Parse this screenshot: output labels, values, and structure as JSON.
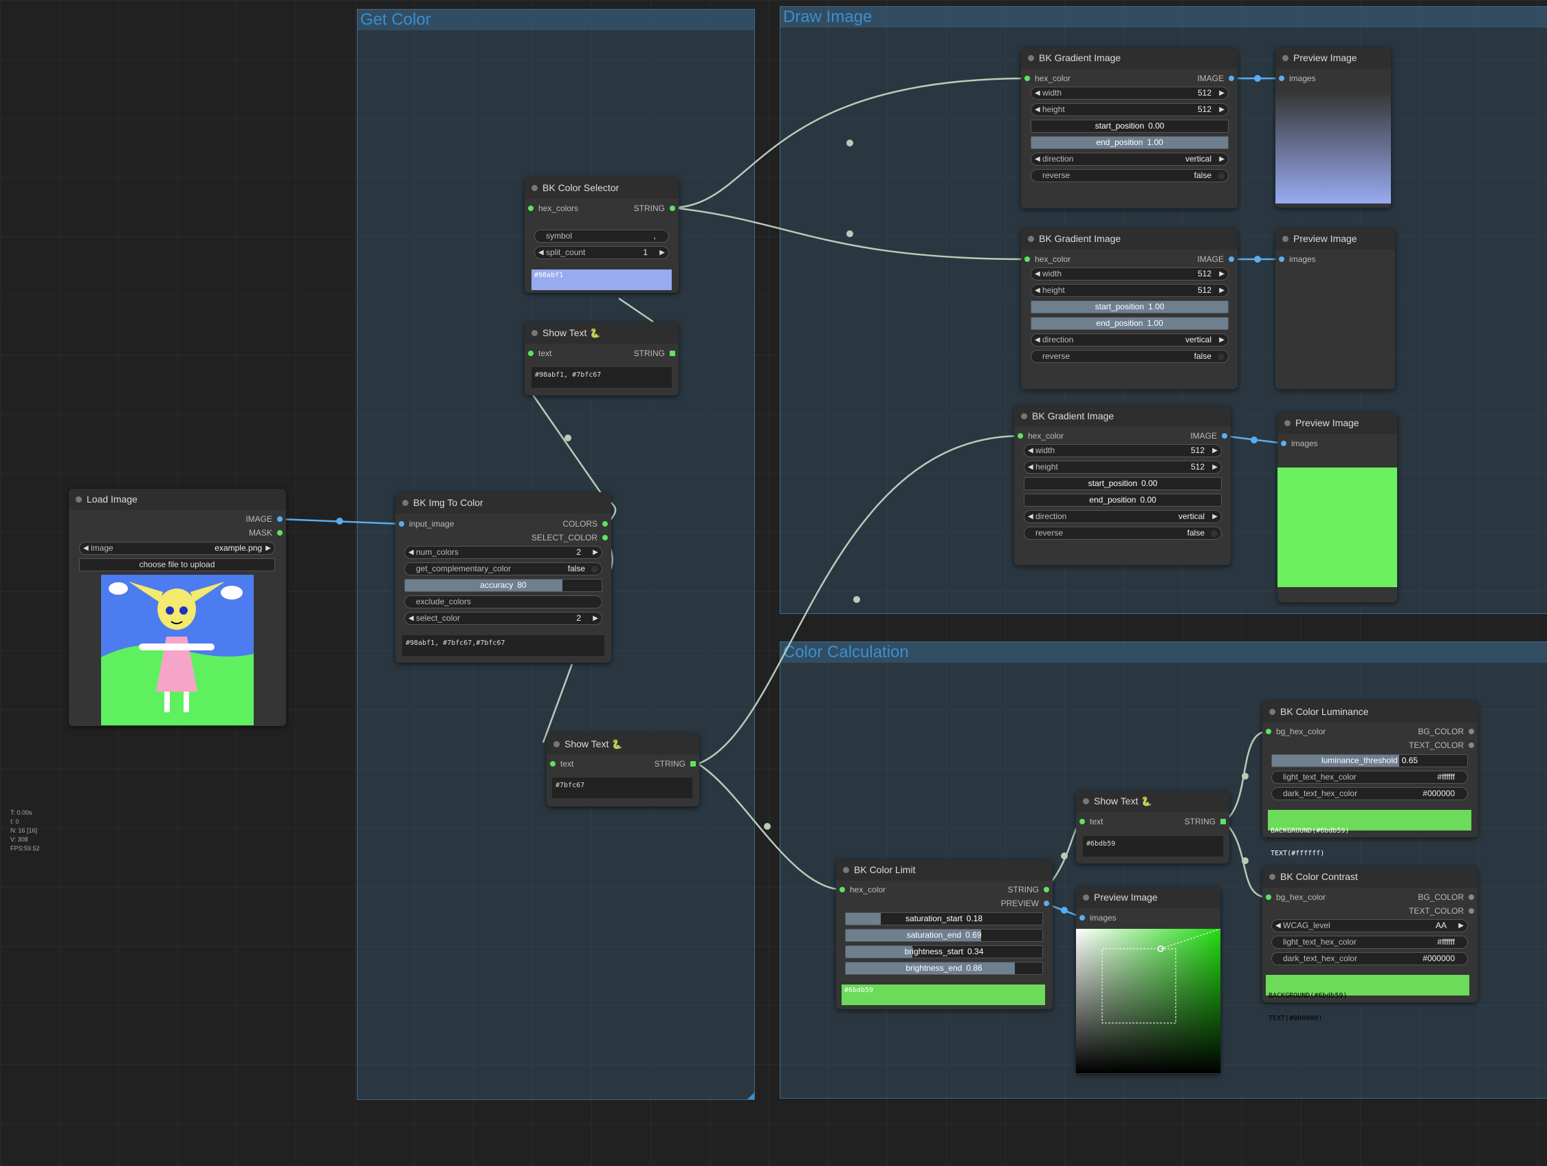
{
  "groups": {
    "get_color": "Get Color",
    "draw_image": "Draw Image",
    "color_calculation": "Color Calculation"
  },
  "load_image": {
    "title": "Load Image",
    "out_image": "IMAGE",
    "out_mask": "MASK",
    "image_label": "image",
    "image_value": "example.png",
    "upload_button": "choose file to upload"
  },
  "color_selector": {
    "title": "BK Color Selector",
    "in_hex_colors": "hex_colors",
    "out_string": "STRING",
    "symbol_label": "symbol",
    "symbol_value": ",",
    "split_count_label": "split_count",
    "split_count_value": "1",
    "swatch_text": "#98abf1",
    "swatch_color": "#98abf1"
  },
  "show_text_1": {
    "title": "Show Text",
    "in_text": "text",
    "out_string": "STRING",
    "content": "#98abf1, #7bfc67"
  },
  "img_to_color": {
    "title": "BK Img To Color",
    "in_input_image": "input_image",
    "out_colors": "COLORS",
    "out_select_color": "SELECT_COLOR",
    "num_colors_label": "num_colors",
    "num_colors_value": "2",
    "get_complementary_label": "get_complementary_color",
    "get_complementary_value": "false",
    "accuracy_label": "accuracy",
    "accuracy_value": "80",
    "accuracy_fraction": 0.8,
    "exclude_colors_label": "exclude_colors",
    "select_color_label": "select_color",
    "select_color_value": "2",
    "output_text": "#98abf1, #7bfc67,#7bfc67"
  },
  "show_text_2": {
    "title": "Show Text",
    "in_text": "text",
    "out_string": "STRING",
    "content": "#7bfc67"
  },
  "gradient_1": {
    "title": "BK Gradient Image",
    "in_hex_color": "hex_color",
    "out_image": "IMAGE",
    "width_label": "width",
    "width_value": "512",
    "height_label": "height",
    "height_value": "512",
    "start_position_label": "start_position",
    "start_position_value": "0.00",
    "start_position_fraction": 0.0,
    "end_position_label": "end_position",
    "end_position_value": "1.00",
    "end_position_fraction": 1.0,
    "direction_label": "direction",
    "direction_value": "vertical",
    "reverse_label": "reverse",
    "reverse_value": "false"
  },
  "gradient_2": {
    "title": "BK Gradient Image",
    "in_hex_color": "hex_color",
    "out_image": "IMAGE",
    "width_label": "width",
    "width_value": "512",
    "height_label": "height",
    "height_value": "512",
    "start_position_label": "start_position",
    "start_position_value": "1.00",
    "start_position_fraction": 1.0,
    "end_position_label": "end_position",
    "end_position_value": "1.00",
    "end_position_fraction": 1.0,
    "direction_label": "direction",
    "direction_value": "vertical",
    "reverse_label": "reverse",
    "reverse_value": "false"
  },
  "gradient_3": {
    "title": "BK Gradient Image",
    "in_hex_color": "hex_color",
    "out_image": "IMAGE",
    "width_label": "width",
    "width_value": "512",
    "height_label": "height",
    "height_value": "512",
    "start_position_label": "start_position",
    "start_position_value": "0.00",
    "start_position_fraction": 0.0,
    "end_position_label": "end_position",
    "end_position_value": "0.00",
    "end_position_fraction": 0.0,
    "direction_label": "direction",
    "direction_value": "vertical",
    "reverse_label": "reverse",
    "reverse_value": "false"
  },
  "preview_1": {
    "title": "Preview Image",
    "in_images": "images"
  },
  "preview_2": {
    "title": "Preview Image",
    "in_images": "images"
  },
  "preview_3": {
    "title": "Preview Image",
    "in_images": "images",
    "fill_color": "#6cf05f"
  },
  "preview_4": {
    "title": "Preview Image",
    "in_images": "images"
  },
  "color_limit": {
    "title": "BK Color Limit",
    "in_hex_color": "hex_color",
    "out_string": "STRING",
    "out_preview": "PREVIEW",
    "saturation_start_label": "saturation_start",
    "saturation_start_value": "0.18",
    "saturation_start_fraction": 0.18,
    "saturation_end_label": "saturation_end",
    "saturation_end_value": "0.69",
    "saturation_end_fraction": 0.69,
    "brightness_start_label": "brightness_start",
    "brightness_start_value": "0.34",
    "brightness_start_fraction": 0.34,
    "brightness_end_label": "brightness_end",
    "brightness_end_value": "0.86",
    "brightness_end_fraction": 0.86,
    "swatch_text": "#6bdb59",
    "swatch_color": "#6bdb59"
  },
  "show_text_3": {
    "title": "Show Text",
    "in_text": "text",
    "out_string": "STRING",
    "content": "#6bdb59"
  },
  "luminance": {
    "title": "BK Color Luminance",
    "in_bg_hex_color": "bg_hex_color",
    "out_bg_color": "BG_COLOR",
    "out_text_color": "TEXT_COLOR",
    "luminance_threshold_label": "luminance_threshold",
    "luminance_threshold_value": "0.65",
    "luminance_threshold_fraction": 0.65,
    "light_text_label": "light_text_hex_color",
    "light_text_value": "#ffffff",
    "dark_text_label": "dark_text_hex_color",
    "dark_text_value": "#000000",
    "result_line1": "BACKGROUND(#6bdb59)",
    "result_line2": "TEXT(#ffffff)"
  },
  "contrast": {
    "title": "BK Color Contrast",
    "in_bg_hex_color": "bg_hex_color",
    "out_bg_color": "BG_COLOR",
    "out_text_color": "TEXT_COLOR",
    "wcag_label": "WCAG_level",
    "wcag_value": "AA",
    "light_text_label": "light_text_hex_color",
    "light_text_value": "#ffffff",
    "dark_text_label": "dark_text_hex_color",
    "dark_text_value": "#000000",
    "result_line1": "BACKGROUND(#6bdb59)",
    "result_line2": "TEXT(#000000)"
  },
  "hud": {
    "t": "T: 0.00s",
    "i": "I: 0",
    "n": "N: 16 [16]",
    "v": "V: 308",
    "fps": "FPS:59.52"
  }
}
